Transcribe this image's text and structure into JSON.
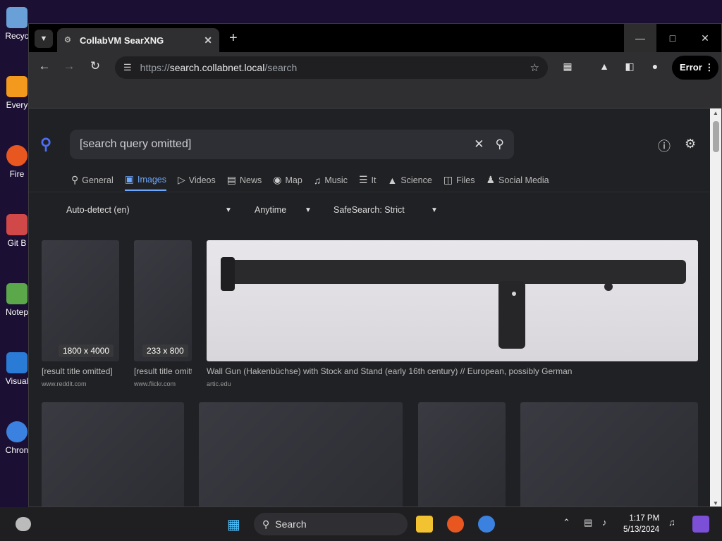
{
  "desktop": {
    "icons": [
      "Recyc",
      "Every",
      "Fire",
      "Git B",
      "Notep",
      "Visual",
      "Chron"
    ]
  },
  "browser": {
    "tab_title": "CollabVM SearXNG",
    "url_scheme": "https://",
    "url_host": "search.collabnet.local",
    "url_path": "/search",
    "profile_pill": "Error"
  },
  "search": {
    "query": "[search query omitted]",
    "categories": [
      "General",
      "Images",
      "Videos",
      "News",
      "Map",
      "Music",
      "It",
      "Science",
      "Files",
      "Social Media"
    ],
    "active_category": "Images",
    "filters": {
      "language": "Auto-detect (en)",
      "time": "Anytime",
      "safesearch": "SafeSearch: Strict"
    }
  },
  "results": [
    {
      "title": "[result title omitted]",
      "site": "www.reddit.com",
      "dims": "1800 x 4000"
    },
    {
      "title": "[result title omitted]",
      "site": "www.flickr.com",
      "dims": "233 x 800"
    },
    {
      "title": "Wall Gun (Hakenbüchse) with Stock and Stand (early 16th century) // European, possibly German",
      "site": "artic.edu",
      "dims": ""
    }
  ],
  "taskbar": {
    "search_label": "Search",
    "time": "1:17 PM",
    "date": "5/13/2024"
  },
  "colors": {
    "accent": "#6ea8fe",
    "desktop_bg": "#1b1033",
    "chrome_bg": "#2f2f31"
  }
}
